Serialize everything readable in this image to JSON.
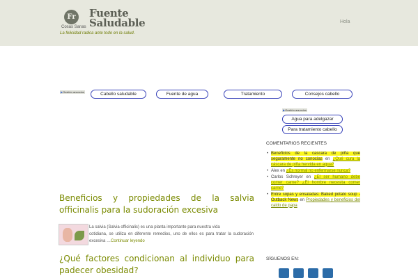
{
  "header": {
    "logo_monogram": "Fr",
    "logo_small_text": "Cosas Sanas",
    "logo_line1": "Fuente",
    "logo_line2": "Saludable",
    "tagline": "La felicidad radica ante todo en la salud.",
    "nav_link": "Hola"
  },
  "ads_label": "Gestión anuncios",
  "ad_links": [
    "Cabello saludable",
    "Fuente de agua",
    "Tratamiento",
    "Consejos cabello"
  ],
  "sidebar_ad_links": [
    "Agua para adelgazar",
    "Para tratamiento cabello"
  ],
  "posts": [
    {
      "title": "Beneficios y propiedades de la salvia officinalis para la sudoración excesiva",
      "excerpt_line1": "La salvia (Salvia officinalis) es una planta importante para nuestra vida",
      "excerpt_rest": "cotidiana, se utiliza en diferente remedios, uno de ellos es para tratar la sudoración excesiva …",
      "more_link": "Continuar leyendo"
    },
    {
      "title": "¿Qué factores condicionan al individuo para padecer obesidad?"
    }
  ],
  "sidebar": {
    "recent_comments_heading": "COMENTARIOS RECIENTES",
    "comments": [
      {
        "author": "Beneficios de la cascara de piña que seguramente no conocías",
        "sep": " en ",
        "post": "¿Qué cura la cáscara de piña hervida en agua?"
      },
      {
        "author": "Alex",
        "sep": " en ",
        "post": "¿Es normal no enfermarse nunca?"
      },
      {
        "author": "Carlos Schreyer",
        "sep": " en ",
        "post": "¿El ser humano debe comer carne? ¿El hombre necesita comer carne?"
      },
      {
        "author": "Entre sopas y ensaladas: Baked potato soup - Outback News",
        "sep": " en ",
        "post": "Propiedades y beneficios del caldo de papa"
      }
    ],
    "follow_heading": "SÍGUENOS EN:",
    "social_icons": [
      "facebook-icon",
      "twitter-icon",
      "pinterest-icon",
      "rss-icon"
    ]
  },
  "colors": {
    "header_bg": "#e7e8de",
    "accent_green": "#7a8a00",
    "highlight_yellow": "#fbf71e",
    "adlink_border": "#3540b8"
  }
}
